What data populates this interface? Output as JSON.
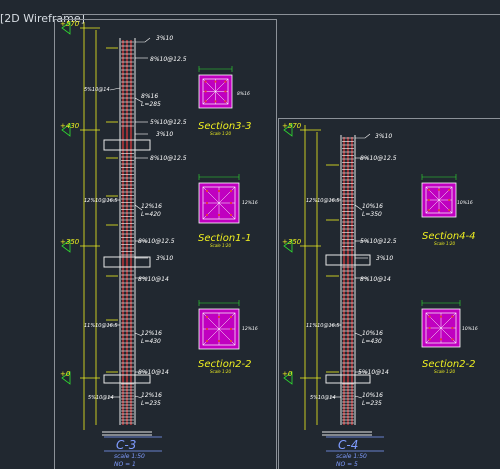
{
  "viewport": {
    "label": "[2D Wireframe]",
    "colors": {
      "background": "#212830",
      "frame": "#8c9198",
      "concrete": "#e8e8e8",
      "rebar": "#e63a3a",
      "stirrup": "#ffffff",
      "dim": "#f0f020",
      "text": "#ffffff",
      "section_fill": "#c000c0",
      "title": "#7f9cff",
      "level_mark": "#30e030"
    }
  },
  "column_c3": {
    "title": "C-3",
    "scale": "scale 1:50",
    "count": "NO = 1",
    "levels": [
      "+570",
      "+430",
      "+350",
      "+0"
    ],
    "labels": {
      "top_bar": "3%10",
      "stirrups_top": "8%10@12.5",
      "stirrups_mid1": "8%10@12.5",
      "stirrups_mid2": "8%10@14",
      "stirrups_lap1": "5%10@12.5",
      "stirrups_lap2": "8%10@12.5",
      "stirrups_bot": "8%10@14",
      "stirrups_base": "5%10@14",
      "bar_a": "8%16",
      "bar_a_len": "L=285",
      "bar_b": "12%16",
      "bar_b_len": "L=420",
      "bar_c": "12%16",
      "bar_c_len": "L=430",
      "bar_d": "12%16",
      "bar_d_len": "L=235",
      "stir_left1": "12%10@16.5",
      "stir_left2": "11%10@16.5",
      "dim_a": "3%10",
      "dim_b": "3%10"
    },
    "sections": [
      {
        "name": "Section3-3",
        "scale": "Scale 1:20",
        "bars": "8%16"
      },
      {
        "name": "Section1-1",
        "scale": "Scale 1:20",
        "bars": "12%16"
      },
      {
        "name": "Section2-2",
        "scale": "Scale 1:20",
        "bars": "12%16"
      }
    ]
  },
  "column_c4": {
    "title": "C-4",
    "scale": "scale 1:50",
    "count": "NO = 5",
    "levels": [
      "+570",
      "+350",
      "+0"
    ],
    "labels": {
      "top_bar": "3%10",
      "stirrups_top": "8%10@12.5",
      "bar_a": "10%16",
      "bar_a_len": "L=350",
      "stir_left1": "12%10@16.5",
      "stirrups_lap": "5%10@12.5",
      "dim_a": "3%10",
      "stirrups_mid": "8%10@14",
      "stir_left2": "11%10@16.5",
      "bar_b": "10%16",
      "bar_b_len": "L=430",
      "stirrups_bot": "5%10@14",
      "stirrups_base": "5%10@14",
      "bar_c": "10%16",
      "bar_c_len": "L=235"
    },
    "sections": [
      {
        "name": "Section4-4",
        "scale": "Scale 1:20",
        "bars": "10%16"
      },
      {
        "name": "Section2-2",
        "scale": "Scale 1:20",
        "bars": "10%16"
      }
    ]
  }
}
